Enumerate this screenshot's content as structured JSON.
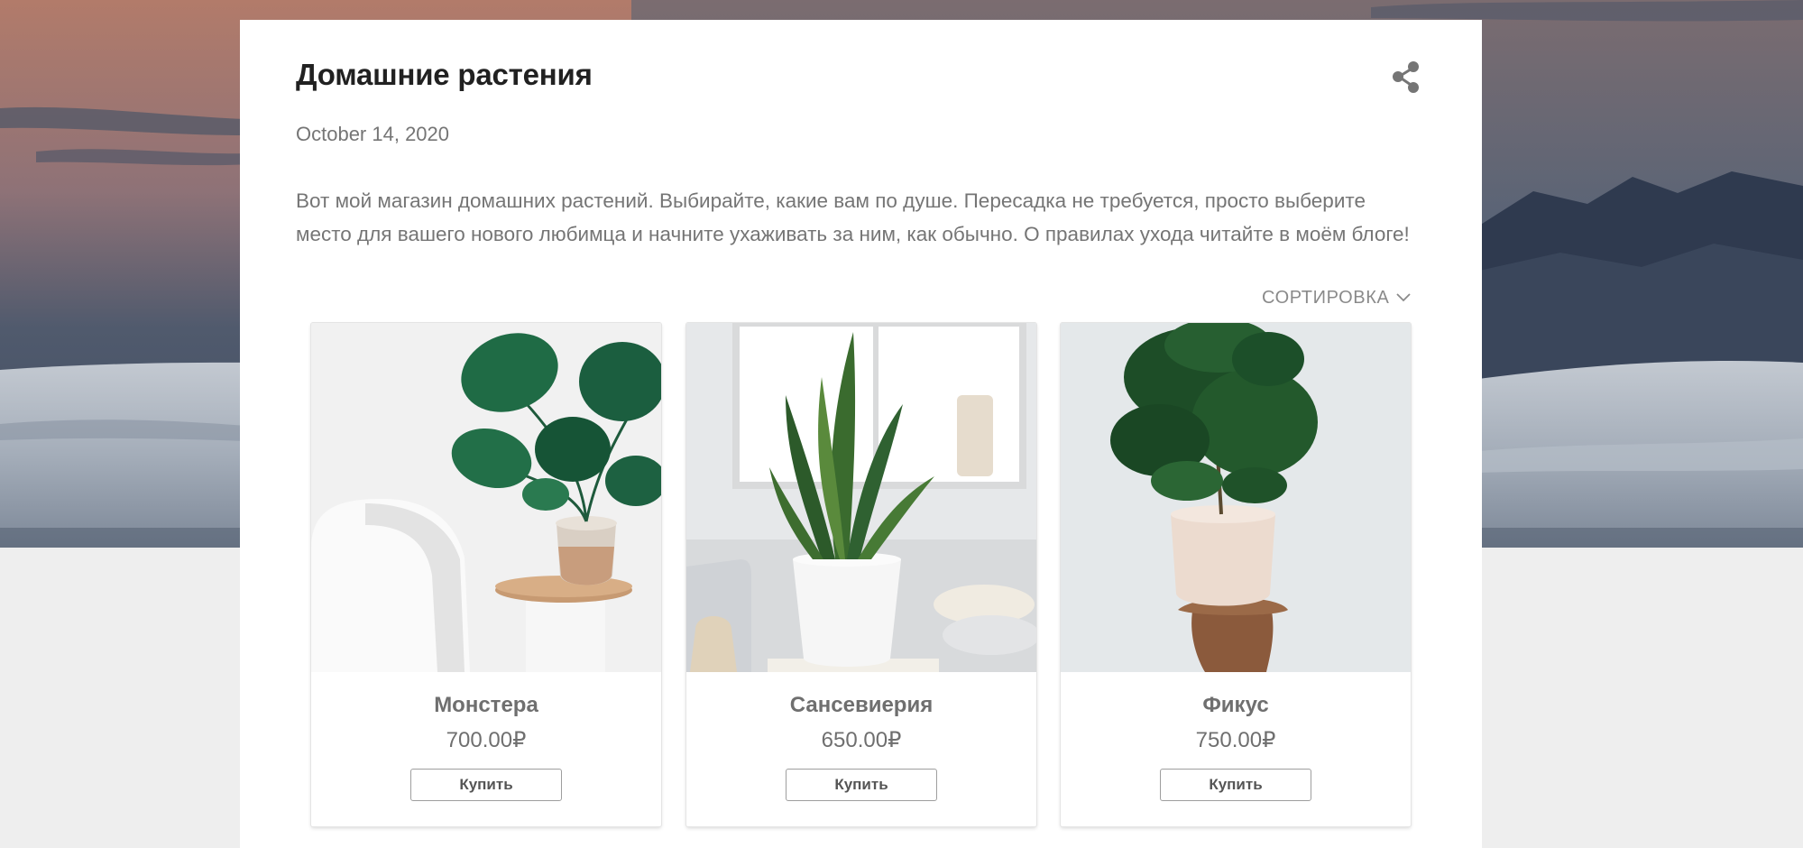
{
  "post": {
    "title": "Домашние растения",
    "date": "October 14, 2020",
    "body": "Вот мой магазин домашних растений. Выбирайте, какие вам по душе. Пересадка не требуется, просто выберите место для вашего нового любимца и начните ухаживать за ним, как обычно. О правилах ухода читайте в моём блоге!"
  },
  "share": {
    "icon": "share-icon"
  },
  "sort": {
    "label": "СОРТИРОВКА",
    "icon": "chevron-down-icon"
  },
  "products": [
    {
      "name": "Монстера",
      "price": "700.00₽",
      "button": "Купить"
    },
    {
      "name": "Сансевиерия",
      "price": "650.00₽",
      "button": "Купить"
    },
    {
      "name": "Фикус",
      "price": "750.00₽",
      "button": "Купить"
    }
  ],
  "colors": {
    "card_background": "#ffffff",
    "page_background": "#eeeeee",
    "title_text": "#212121",
    "secondary_text": "#757575"
  }
}
